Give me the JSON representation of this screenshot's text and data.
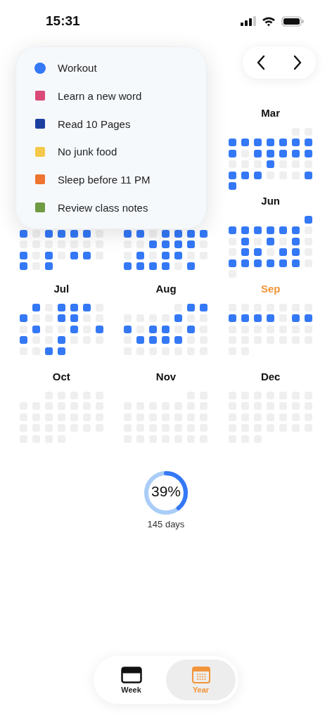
{
  "status_bar": {
    "time": "15:31"
  },
  "habits": [
    {
      "name": "Workout",
      "color": "#3478f6",
      "selected": true
    },
    {
      "name": "Learn a new word",
      "color": "#d94a78",
      "selected": false
    },
    {
      "name": "Read 10 Pages",
      "color": "#1c3f9f",
      "selected": false
    },
    {
      "name": "No junk food",
      "color": "#f4c94a",
      "selected": false
    },
    {
      "name": "Sleep before 11 PM",
      "color": "#ee7430",
      "selected": false
    },
    {
      "name": "Review class notes",
      "color": "#6f9b45",
      "selected": false
    }
  ],
  "months": [
    {
      "label": "Mar",
      "current": false,
      "rows": [
        [
          null,
          null,
          null,
          null,
          null,
          false,
          false
        ],
        [
          true,
          true,
          true,
          true,
          true,
          true,
          true
        ],
        [
          true,
          false,
          true,
          true,
          true,
          true,
          true
        ],
        [
          false,
          false,
          false,
          true,
          false,
          false,
          false
        ],
        [
          true,
          true,
          true,
          false,
          false,
          false,
          true
        ],
        [
          true,
          null,
          null,
          null,
          null,
          null,
          null
        ]
      ]
    },
    {
      "rows": [
        [
          true,
          false,
          true,
          true,
          true,
          true,
          false
        ],
        [
          false,
          false,
          false,
          false,
          false,
          false,
          false
        ],
        [
          true,
          false,
          true,
          false,
          true,
          true,
          false
        ],
        [
          true,
          false,
          true,
          null,
          null,
          null,
          null
        ]
      ]
    },
    {
      "rows": [
        [
          true,
          true,
          false,
          true,
          true,
          true,
          true
        ],
        [
          false,
          false,
          true,
          true,
          true,
          true,
          false
        ],
        [
          false,
          true,
          false,
          true,
          true,
          false,
          false
        ],
        [
          true,
          true,
          true,
          true,
          false,
          true,
          null
        ]
      ]
    },
    {
      "label": "Jun",
      "current": false,
      "rows": [
        [
          null,
          null,
          null,
          null,
          null,
          null,
          true
        ],
        [
          true,
          true,
          true,
          true,
          true,
          true,
          false
        ],
        [
          false,
          true,
          false,
          true,
          false,
          true,
          false
        ],
        [
          false,
          true,
          true,
          false,
          true,
          true,
          false
        ],
        [
          true,
          true,
          true,
          true,
          true,
          true,
          false
        ],
        [
          false,
          null,
          null,
          null,
          null,
          null,
          null
        ]
      ]
    },
    {
      "label": "Jul",
      "current": false,
      "rows": [
        [
          null,
          true,
          false,
          true,
          true,
          true,
          false
        ],
        [
          true,
          false,
          false,
          true,
          true,
          false,
          false
        ],
        [
          false,
          true,
          false,
          false,
          true,
          false,
          true
        ],
        [
          true,
          false,
          false,
          true,
          false,
          false,
          false
        ],
        [
          false,
          false,
          true,
          true,
          null,
          null,
          null
        ]
      ]
    },
    {
      "label": "Aug",
      "current": false,
      "rows": [
        [
          null,
          null,
          null,
          null,
          false,
          true,
          true
        ],
        [
          false,
          false,
          false,
          false,
          true,
          false,
          false
        ],
        [
          true,
          false,
          true,
          true,
          false,
          true,
          false
        ],
        [
          false,
          true,
          true,
          true,
          true,
          false,
          false
        ],
        [
          false,
          false,
          false,
          false,
          false,
          false,
          false
        ]
      ]
    },
    {
      "label": "Sep",
      "current": true,
      "rows": [
        [
          false,
          false,
          false,
          false,
          false,
          false,
          false
        ],
        [
          true,
          true,
          true,
          true,
          false,
          true,
          true
        ],
        [
          false,
          false,
          false,
          false,
          false,
          false,
          false
        ],
        [
          false,
          false,
          false,
          false,
          false,
          false,
          false
        ],
        [
          false,
          false,
          null,
          null,
          null,
          null,
          null
        ]
      ]
    },
    {
      "label": "Oct",
      "current": false,
      "rows": [
        [
          null,
          null,
          false,
          false,
          false,
          false,
          false
        ],
        [
          false,
          false,
          false,
          false,
          false,
          false,
          false
        ],
        [
          false,
          false,
          false,
          false,
          false,
          false,
          false
        ],
        [
          false,
          false,
          false,
          false,
          false,
          false,
          false
        ],
        [
          false,
          false,
          false,
          false,
          null,
          null,
          null
        ]
      ]
    },
    {
      "label": "Nov",
      "current": false,
      "rows": [
        [
          null,
          null,
          null,
          null,
          null,
          false,
          false
        ],
        [
          false,
          false,
          false,
          false,
          false,
          false,
          false
        ],
        [
          false,
          false,
          false,
          false,
          false,
          false,
          false
        ],
        [
          false,
          false,
          false,
          false,
          false,
          false,
          false
        ],
        [
          false,
          false,
          false,
          false,
          false,
          false,
          false
        ]
      ]
    },
    {
      "label": "Dec",
      "current": false,
      "rows": [
        [
          false,
          false,
          false,
          false,
          false,
          false,
          false
        ],
        [
          false,
          false,
          false,
          false,
          false,
          false,
          false
        ],
        [
          false,
          false,
          false,
          false,
          false,
          false,
          false
        ],
        [
          false,
          false,
          false,
          false,
          false,
          false,
          false
        ],
        [
          false,
          false,
          false,
          null,
          null,
          null,
          null
        ]
      ]
    }
  ],
  "progress": {
    "percent": "39%",
    "level": 0.39,
    "caption": "145 days"
  },
  "tabs": [
    {
      "label": "Week",
      "selected": false
    },
    {
      "label": "Year",
      "selected": true
    }
  ]
}
